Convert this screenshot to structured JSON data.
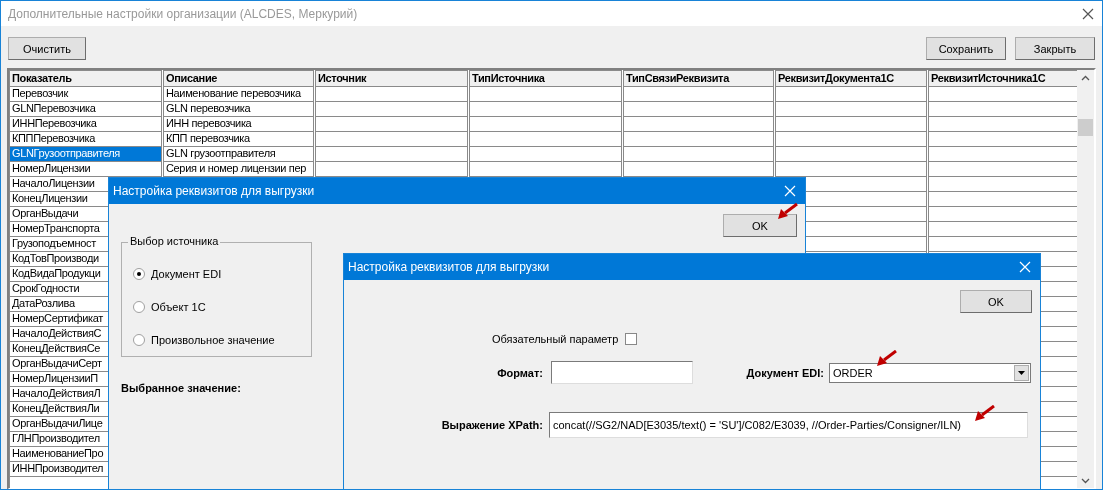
{
  "window": {
    "title": "Дополнительные настройки организации (ALCDES, Меркурий)"
  },
  "toolbar": {
    "left_buttons": [
      "Очистить"
    ],
    "right_buttons": [
      "Сохранить",
      "Закрыть"
    ]
  },
  "table": {
    "columns": [
      "Показатель",
      "Описание",
      "Источник",
      "ТипИсточника",
      "ТипСвязиРеквизита",
      "РеквизитДокумента1С",
      "РеквизитИсточника1С"
    ],
    "rows": [
      {
        "cells": [
          "Перевозчик",
          "Наименование перевозчика"
        ],
        "selected": false
      },
      {
        "cells": [
          "GLNПеревозчика",
          "GLN перевозчика"
        ],
        "selected": false
      },
      {
        "cells": [
          "ИННПеревозчика",
          "ИНН перевозчика"
        ],
        "selected": false
      },
      {
        "cells": [
          "КПППеревозчика",
          "КПП перевозчика"
        ],
        "selected": false
      },
      {
        "cells": [
          "GLNГрузоотправителя",
          "GLN грузоотправителя"
        ],
        "selected": true
      },
      {
        "cells": [
          "НомерЛицензии",
          "Серия и номер лицензии пер"
        ],
        "selected": false
      },
      {
        "cells": [
          "НачалоЛицензии"
        ],
        "selected": false
      },
      {
        "cells": [
          "КонецЛицензии"
        ],
        "selected": false
      },
      {
        "cells": [
          "ОрганВыдачи"
        ],
        "selected": false
      },
      {
        "cells": [
          "НомерТранспорта"
        ],
        "selected": false
      },
      {
        "cells": [
          "Грузоподъемност"
        ],
        "selected": false
      },
      {
        "cells": [
          "КодТовПроизводи"
        ],
        "selected": false
      },
      {
        "cells": [
          "КодВидаПродукци"
        ],
        "selected": false
      },
      {
        "cells": [
          "СрокГодности"
        ],
        "selected": false
      },
      {
        "cells": [
          "ДатаРозлива"
        ],
        "selected": false
      },
      {
        "cells": [
          "НомерСертификат"
        ],
        "selected": false
      },
      {
        "cells": [
          "НачалоДействияС"
        ],
        "selected": false
      },
      {
        "cells": [
          "КонецДействияСе"
        ],
        "selected": false
      },
      {
        "cells": [
          "ОрганВыдачиСерт"
        ],
        "selected": false
      },
      {
        "cells": [
          "НомерЛицензииП"
        ],
        "selected": false
      },
      {
        "cells": [
          "НачалоДействияЛ"
        ],
        "selected": false
      },
      {
        "cells": [
          "КонецДействияЛи"
        ],
        "selected": false
      },
      {
        "cells": [
          "ОрганВыдачиЛице"
        ],
        "selected": false
      },
      {
        "cells": [
          "ГЛНПроизводител"
        ],
        "selected": false
      },
      {
        "cells": [
          "НаименованиеПро"
        ],
        "selected": false
      },
      {
        "cells": [
          "ИННПроизводител"
        ],
        "selected": false
      },
      {
        "cells": [],
        "selected": false
      }
    ]
  },
  "source_dialog": {
    "title": "Настройка реквизитов для выгрузки",
    "ok": "OK",
    "group_title": "Выбор источника",
    "options": [
      {
        "label": "Документ EDI",
        "selected": true
      },
      {
        "label": "Объект 1С",
        "selected": false
      },
      {
        "label": "Произвольное значение",
        "selected": false
      }
    ],
    "selected_value_label": "Выбранное значение:"
  },
  "attribute_dialog": {
    "title": "Настройка реквизитов для выгрузки",
    "ok": "OK",
    "required": {
      "label": "Обязательный параметр",
      "checked": false
    },
    "format": {
      "label": "Формат:"
    },
    "edi_document": {
      "label": "Документ EDI:",
      "value": "ORDER"
    },
    "xpath": {
      "label": "Выражение XPath:",
      "value": "concat(//SG2/NAD[E3035/text() = 'SU']/C082/E3039, //Order-Parties/Consigner/ILN)"
    }
  }
}
